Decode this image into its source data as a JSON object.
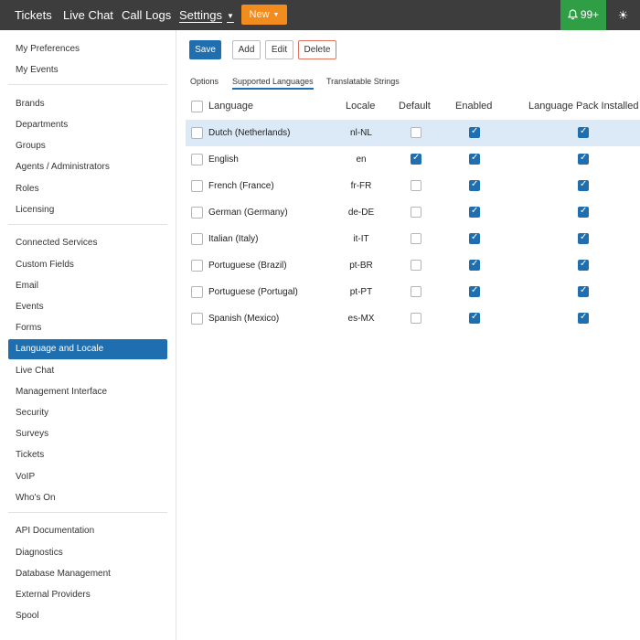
{
  "topnav": {
    "items": [
      "Tickets",
      "Live Chat",
      "Call Logs",
      "Settings"
    ],
    "new_label": "New",
    "notifications": "99+"
  },
  "sidebar": {
    "groups": [
      [
        "My Preferences",
        "My Events"
      ],
      [
        "Brands",
        "Departments",
        "Groups",
        "Agents / Administrators",
        "Roles",
        "Licensing"
      ],
      [
        "Connected Services",
        "Custom Fields",
        "Email",
        "Events",
        "Forms",
        "Language and Locale",
        "Live Chat",
        "Management Interface",
        "Security",
        "Surveys",
        "Tickets",
        "VoIP",
        "Who's On"
      ],
      [
        "API Documentation",
        "Diagnostics",
        "Database Management",
        "External Providers",
        "Spool"
      ]
    ],
    "active": "Language and Locale"
  },
  "toolbar": {
    "save": "Save",
    "add": "Add",
    "edit": "Edit",
    "delete": "Delete"
  },
  "subtabs": [
    "Options",
    "Supported Languages",
    "Translatable Strings"
  ],
  "active_subtab": "Supported Languages",
  "table": {
    "headers": [
      "Language",
      "Locale",
      "Default",
      "Enabled",
      "Language Pack Installed"
    ],
    "rows": [
      {
        "language": "Dutch (Netherlands)",
        "locale": "nl-NL",
        "default": false,
        "enabled": true,
        "pack": true,
        "selected": true
      },
      {
        "language": "English",
        "locale": "en",
        "default": true,
        "enabled": true,
        "pack": true,
        "selected": false
      },
      {
        "language": "French (France)",
        "locale": "fr-FR",
        "default": false,
        "enabled": true,
        "pack": true,
        "selected": false
      },
      {
        "language": "German (Germany)",
        "locale": "de-DE",
        "default": false,
        "enabled": true,
        "pack": true,
        "selected": false
      },
      {
        "language": "Italian (Italy)",
        "locale": "it-IT",
        "default": false,
        "enabled": true,
        "pack": true,
        "selected": false
      },
      {
        "language": "Portuguese (Brazil)",
        "locale": "pt-BR",
        "default": false,
        "enabled": true,
        "pack": true,
        "selected": false
      },
      {
        "language": "Portuguese (Portugal)",
        "locale": "pt-PT",
        "default": false,
        "enabled": true,
        "pack": true,
        "selected": false
      },
      {
        "language": "Spanish (Mexico)",
        "locale": "es-MX",
        "default": false,
        "enabled": true,
        "pack": true,
        "selected": false
      }
    ]
  },
  "colors": {
    "accent": "#1f6fb0",
    "new_button": "#f28c1e",
    "notification": "#2f9e44",
    "topbar": "#3d3d3d"
  },
  "icons": {
    "notifications": "bell-icon",
    "theme": "sun-icon"
  }
}
